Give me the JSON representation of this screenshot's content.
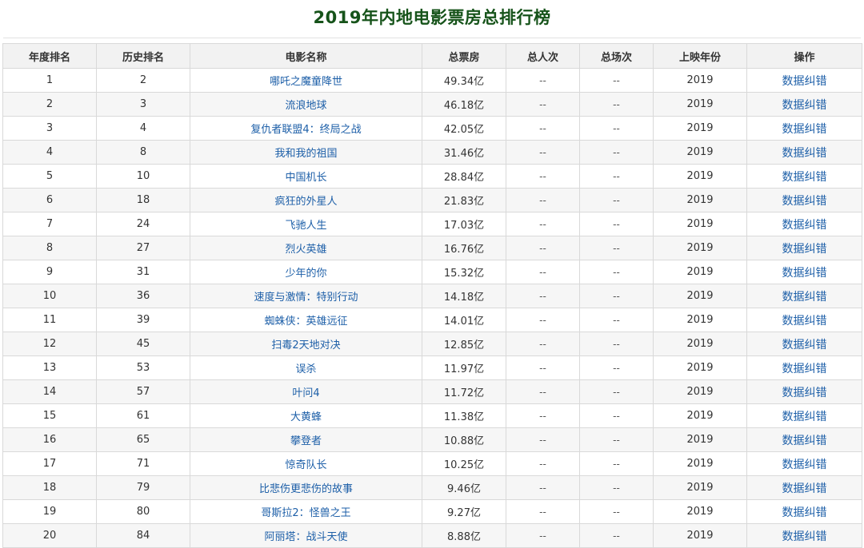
{
  "page": {
    "title": "2019年内地电影票房总排行榜"
  },
  "table": {
    "headers": [
      "年度排名",
      "历史排名",
      "电影名称",
      "总票房",
      "总人次",
      "总场次",
      "上映年份",
      "操作"
    ],
    "rows": [
      {
        "rank": "1",
        "hist": "2",
        "movie": "哪吒之魔童降世",
        "box": "49.34亿",
        "people": "--",
        "shows": "--",
        "year": "2019",
        "action": "数据纠错"
      },
      {
        "rank": "2",
        "hist": "3",
        "movie": "流浪地球",
        "box": "46.18亿",
        "people": "--",
        "shows": "--",
        "year": "2019",
        "action": "数据纠错"
      },
      {
        "rank": "3",
        "hist": "4",
        "movie": "复仇者联盟4：终局之战",
        "box": "42.05亿",
        "people": "--",
        "shows": "--",
        "year": "2019",
        "action": "数据纠错"
      },
      {
        "rank": "4",
        "hist": "8",
        "movie": "我和我的祖国",
        "box": "31.46亿",
        "people": "--",
        "shows": "--",
        "year": "2019",
        "action": "数据纠错"
      },
      {
        "rank": "5",
        "hist": "10",
        "movie": "中国机长",
        "box": "28.84亿",
        "people": "--",
        "shows": "--",
        "year": "2019",
        "action": "数据纠错"
      },
      {
        "rank": "6",
        "hist": "18",
        "movie": "疯狂的外星人",
        "box": "21.83亿",
        "people": "--",
        "shows": "--",
        "year": "2019",
        "action": "数据纠错"
      },
      {
        "rank": "7",
        "hist": "24",
        "movie": "飞驰人生",
        "box": "17.03亿",
        "people": "--",
        "shows": "--",
        "year": "2019",
        "action": "数据纠错"
      },
      {
        "rank": "8",
        "hist": "27",
        "movie": "烈火英雄",
        "box": "16.76亿",
        "people": "--",
        "shows": "--",
        "year": "2019",
        "action": "数据纠错"
      },
      {
        "rank": "9",
        "hist": "31",
        "movie": "少年的你",
        "box": "15.32亿",
        "people": "--",
        "shows": "--",
        "year": "2019",
        "action": "数据纠错"
      },
      {
        "rank": "10",
        "hist": "36",
        "movie": "速度与激情：特别行动",
        "box": "14.18亿",
        "people": "--",
        "shows": "--",
        "year": "2019",
        "action": "数据纠错"
      },
      {
        "rank": "11",
        "hist": "39",
        "movie": "蜘蛛侠：英雄远征",
        "box": "14.01亿",
        "people": "--",
        "shows": "--",
        "year": "2019",
        "action": "数据纠错"
      },
      {
        "rank": "12",
        "hist": "45",
        "movie": "扫毒2天地对决",
        "box": "12.85亿",
        "people": "--",
        "shows": "--",
        "year": "2019",
        "action": "数据纠错"
      },
      {
        "rank": "13",
        "hist": "53",
        "movie": "误杀",
        "box": "11.97亿",
        "people": "--",
        "shows": "--",
        "year": "2019",
        "action": "数据纠错"
      },
      {
        "rank": "14",
        "hist": "57",
        "movie": "叶问4",
        "box": "11.72亿",
        "people": "--",
        "shows": "--",
        "year": "2019",
        "action": "数据纠错"
      },
      {
        "rank": "15",
        "hist": "61",
        "movie": "大黄蜂",
        "box": "11.38亿",
        "people": "--",
        "shows": "--",
        "year": "2019",
        "action": "数据纠错"
      },
      {
        "rank": "16",
        "hist": "65",
        "movie": "攀登者",
        "box": "10.88亿",
        "people": "--",
        "shows": "--",
        "year": "2019",
        "action": "数据纠错"
      },
      {
        "rank": "17",
        "hist": "71",
        "movie": "惊奇队长",
        "box": "10.25亿",
        "people": "--",
        "shows": "--",
        "year": "2019",
        "action": "数据纠错"
      },
      {
        "rank": "18",
        "hist": "79",
        "movie": "比悲伤更悲伤的故事",
        "box": "9.46亿",
        "people": "--",
        "shows": "--",
        "year": "2019",
        "action": "数据纠错"
      },
      {
        "rank": "19",
        "hist": "80",
        "movie": "哥斯拉2：怪兽之王",
        "box": "9.27亿",
        "people": "--",
        "shows": "--",
        "year": "2019",
        "action": "数据纠错"
      },
      {
        "rank": "20",
        "hist": "84",
        "movie": "阿丽塔：战斗天使",
        "box": "8.88亿",
        "people": "--",
        "shows": "--",
        "year": "2019",
        "action": "数据纠错"
      }
    ]
  }
}
